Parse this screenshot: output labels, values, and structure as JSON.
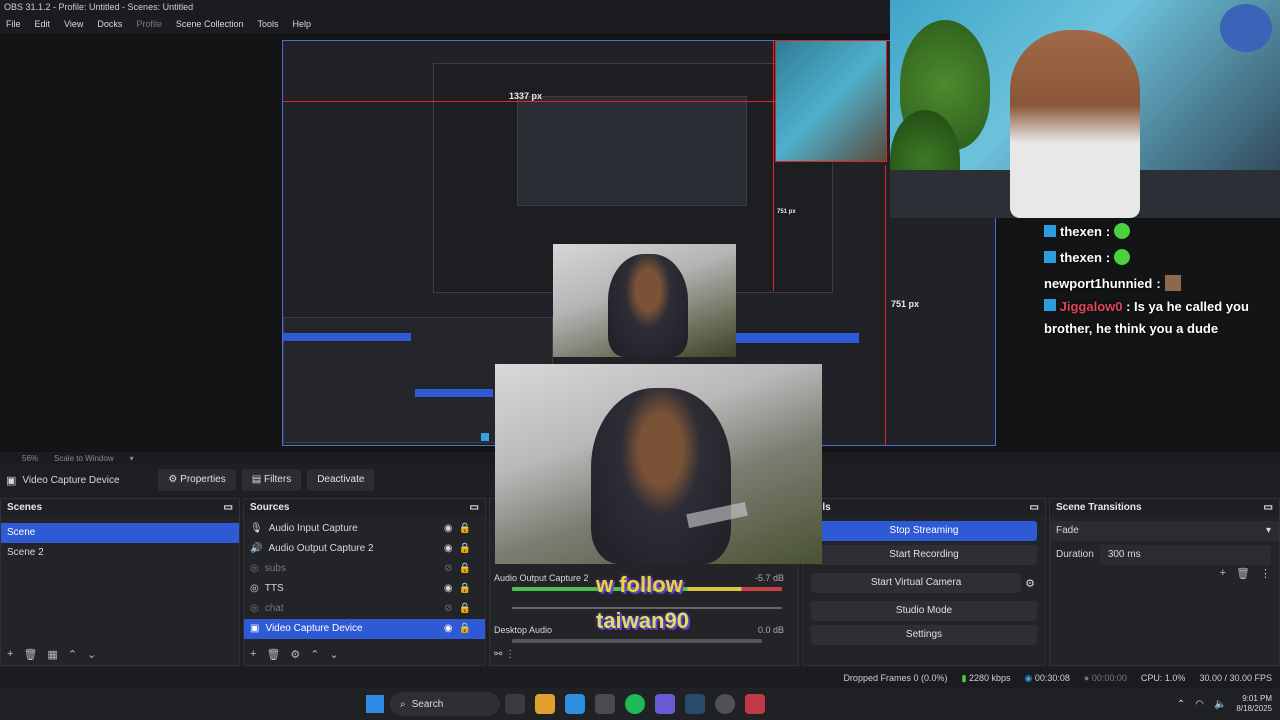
{
  "titlebar": {
    "title": "OBS 31.1.2 - Profile: Untitled - Scenes: Untitled"
  },
  "menu": [
    "File",
    "Edit",
    "View",
    "Docks",
    "Profile",
    "Scene Collection",
    "Tools",
    "Help"
  ],
  "preview": {
    "measure_top": "1337 px",
    "measure_right": "751 px",
    "measure_inner": "751 px"
  },
  "chat": [
    {
      "user": "thexen",
      "sep": " : ",
      "color": "#49d13e"
    },
    {
      "user": "thexen",
      "sep": " : ",
      "color": "#49d13e"
    },
    {
      "user": "newport1hunnied",
      "sep": " : ",
      "color": "#ffffff"
    },
    {
      "user": "Jiggalow0",
      "sep": " : ",
      "message": "Is ya he called you brother, he think you a dude",
      "color": "#e0465a"
    }
  ],
  "zoom": {
    "value": "56%",
    "mode": "Scale to Window"
  },
  "toolbar": {
    "source": "Video Capture Device",
    "properties": "Properties",
    "filters": "Filters",
    "deactivate": "Deactivate"
  },
  "scenes": {
    "title": "Scenes",
    "items": [
      "Scene",
      "Scene 2"
    ],
    "selected": 0
  },
  "sources": {
    "title": "Sources",
    "items": [
      {
        "label": "Audio Input Capture",
        "icon": "mic-icon",
        "dim": false
      },
      {
        "label": "Audio Output Capture 2",
        "icon": "speaker-icon",
        "dim": false
      },
      {
        "label": "subs",
        "icon": "globe-icon",
        "dim": true
      },
      {
        "label": "TTS",
        "icon": "globe-icon",
        "dim": false
      },
      {
        "label": "chat",
        "icon": "globe-icon",
        "dim": true
      },
      {
        "label": "Video Capture Device",
        "icon": "camera-icon",
        "dim": false,
        "selected": true
      }
    ]
  },
  "mixer": {
    "ch1_label": "Audio Output Capture 2",
    "ch1_db": "-5.7 dB",
    "ch2_label": "Desktop Audio",
    "ch2_db": "0.0 dB",
    "overlay1": "w follow",
    "overlay2": "taiwan90"
  },
  "controls": {
    "title": "trols",
    "stop_streaming": "Stop Streaming",
    "start_recording": "Start Recording",
    "start_virtual_camera": "Start Virtual Camera",
    "studio_mode": "Studio Mode",
    "settings": "Settings"
  },
  "transitions": {
    "title": "Scene Transitions",
    "selected": "Fade",
    "duration_label": "Duration",
    "duration_value": "300 ms"
  },
  "status": {
    "dropped": "Dropped Frames 0 (0.0%)",
    "bitrate": "2280 kbps",
    "stream_time": "00:30:08",
    "rec_time": "00:00:00",
    "cpu": "CPU: 1.0%",
    "fps": "30.00 / 30.00 FPS"
  },
  "taskbar": {
    "search": "Search",
    "time": "9:01 PM",
    "date": "8/18/2025"
  },
  "colors": {
    "accent": "#2e5ad6",
    "red_guide": "#e02424"
  }
}
